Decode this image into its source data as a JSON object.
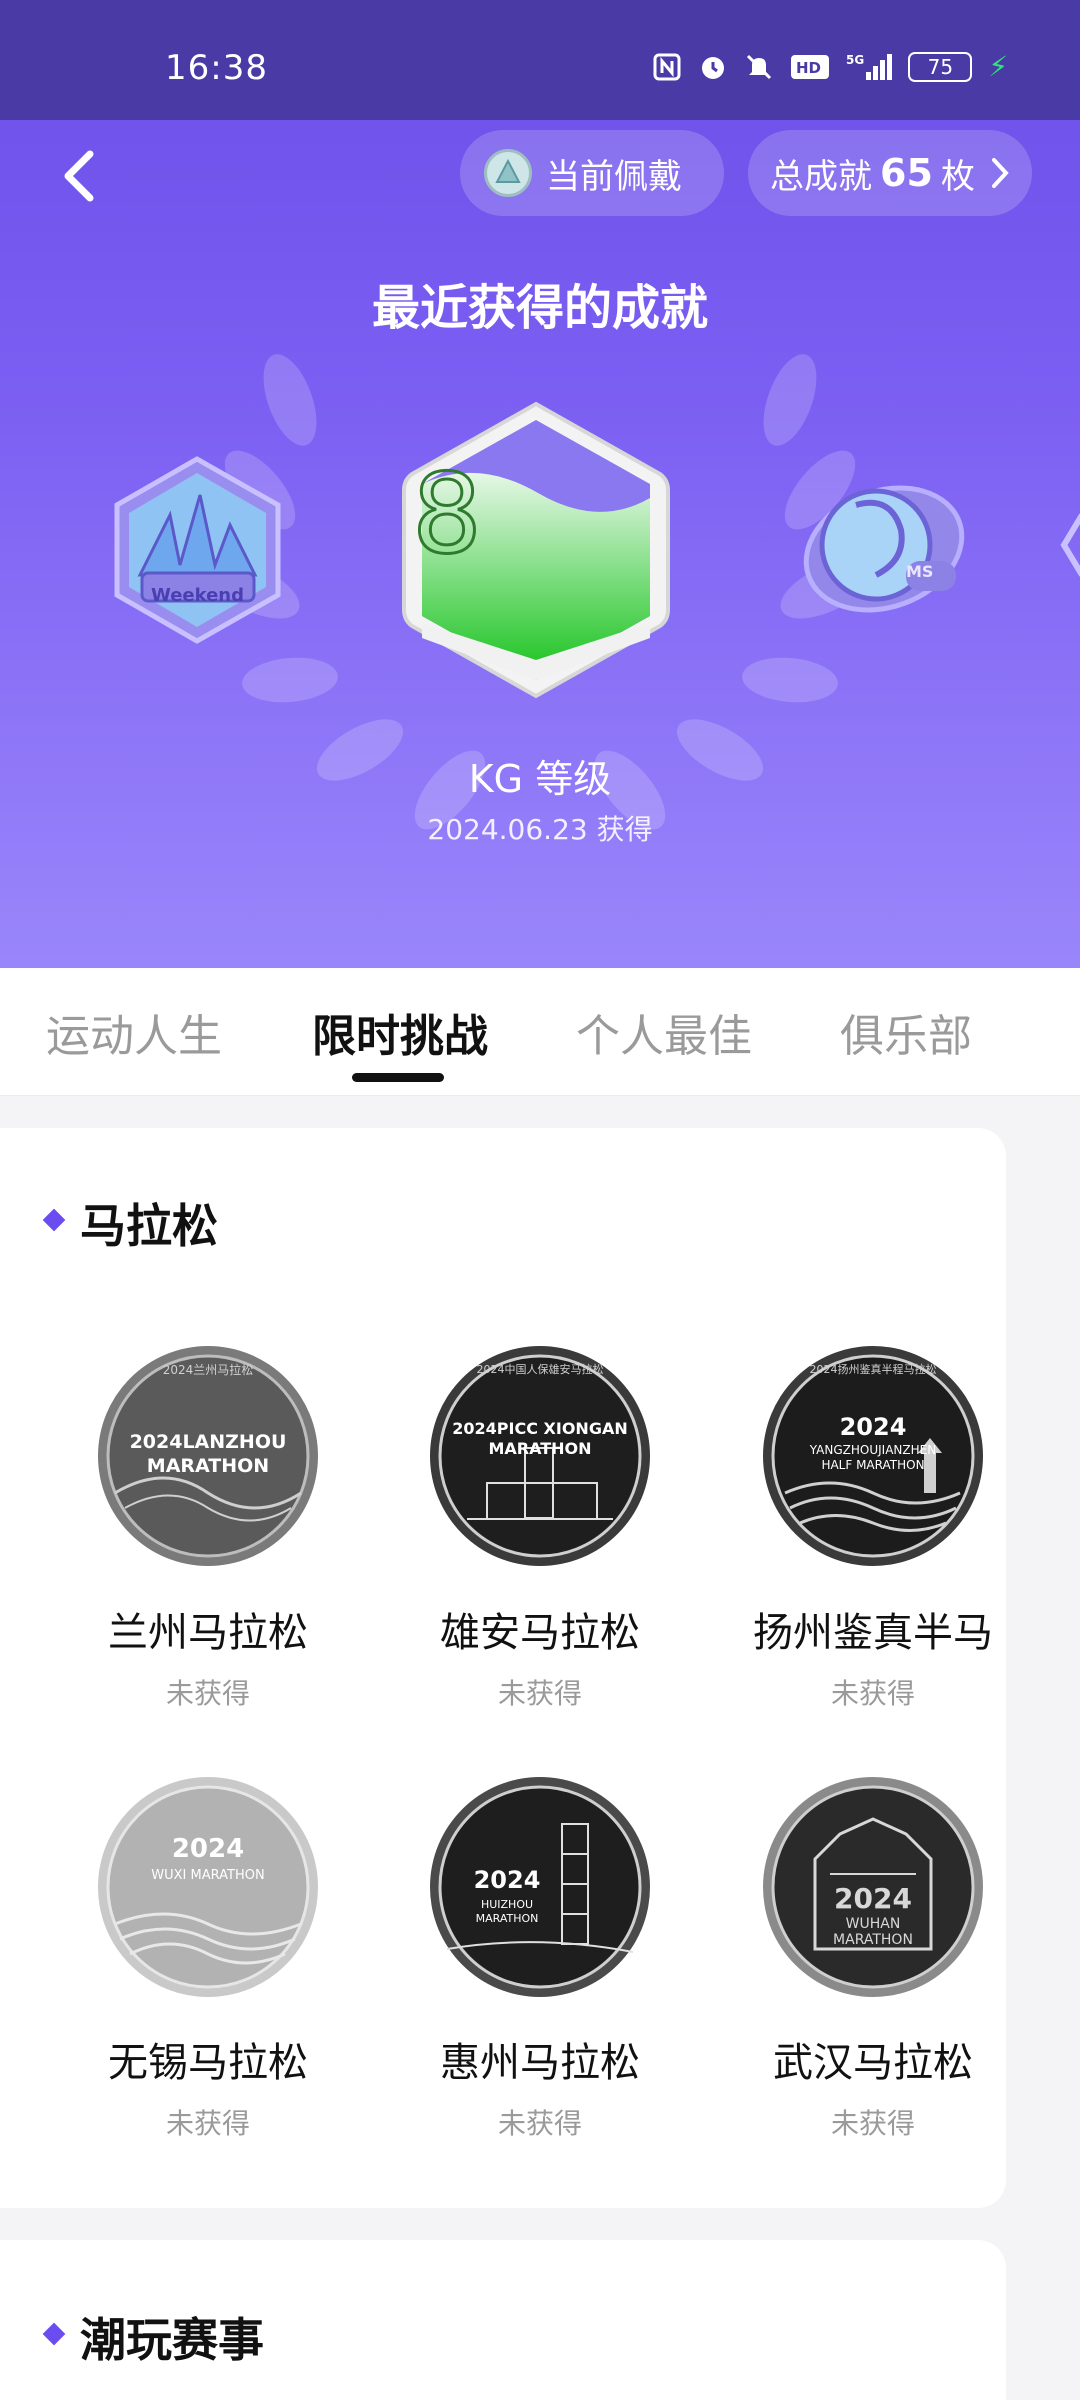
{
  "status_bar": {
    "time": "16:38",
    "battery": "75",
    "icons": [
      "nfc-icon",
      "alarm-icon",
      "mute-icon",
      "hd-icon",
      "signal-5g-icon",
      "battery-icon",
      "charging-icon"
    ]
  },
  "header": {
    "wearing_label": "当前佩戴",
    "total_prefix": "总成就",
    "total_count": "65",
    "total_suffix": "枚"
  },
  "recent": {
    "title": "最近获得的成就",
    "featured_name": "KG 等级",
    "featured_date": "2024.06.23 获得",
    "left_badge_text": "Weekend",
    "center_badge_mark": "8",
    "right_badge_text": "MS"
  },
  "tabs": [
    {
      "label": "运动人生",
      "active": false
    },
    {
      "label": "限时挑战",
      "active": true
    },
    {
      "label": "个人最佳",
      "active": false
    },
    {
      "label": "俱乐部",
      "active": false
    }
  ],
  "sections": [
    {
      "title": "马拉松",
      "medals": [
        {
          "name": "兰州马拉松",
          "status": "未获得",
          "line1": "2024LANZHOU",
          "line2": "MARATHON",
          "rim": "2024兰州马拉松"
        },
        {
          "name": "雄安马拉松",
          "status": "未获得",
          "line1": "2024PICC XIONGAN",
          "line2": "MARATHON",
          "rim": "2024中国人保雄安马拉松"
        },
        {
          "name": "扬州鉴真半马",
          "status": "未获得",
          "line1": "2024",
          "line2": "YANGZHOUJIANZHEN HALF MARATHON",
          "rim": "2024扬州鉴真半程马拉松"
        },
        {
          "name": "无锡马拉松",
          "status": "未获得",
          "line1": "2024",
          "line2": "WUXI MARATHON",
          "rim": ""
        },
        {
          "name": "惠州马拉松",
          "status": "未获得",
          "line1": "2024",
          "line2": "HUIZHOU MARATHON",
          "rim": ""
        },
        {
          "name": "武汉马拉松",
          "status": "未获得",
          "line1": "2024",
          "line2": "WUHAN MARATHON",
          "rim": ""
        }
      ]
    },
    {
      "title": "潮玩赛事"
    }
  ],
  "colors": {
    "accent": "#6a4cf0",
    "hero_top": "#6b4fe8",
    "hero_bottom": "#9a86fb",
    "status_bar": "#4a3aa6"
  }
}
